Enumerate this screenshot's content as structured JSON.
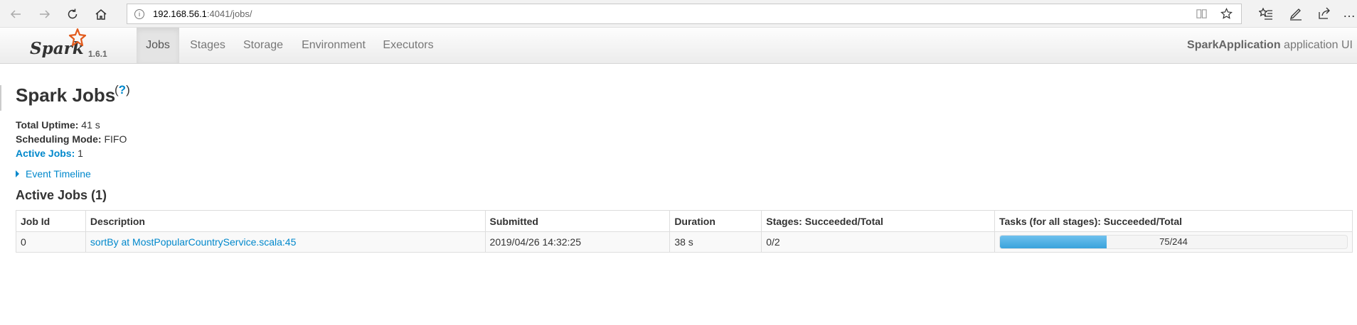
{
  "browser": {
    "url_host": "192.168.56.1",
    "url_rest": ":4041/jobs/"
  },
  "nav": {
    "version": "1.6.1",
    "logo_text": "Spark",
    "tabs": [
      {
        "label": "Jobs",
        "active": true
      },
      {
        "label": "Stages",
        "active": false
      },
      {
        "label": "Storage",
        "active": false
      },
      {
        "label": "Environment",
        "active": false
      },
      {
        "label": "Executors",
        "active": false
      }
    ],
    "app_name": "SparkApplication",
    "app_suffix": "application UI"
  },
  "page": {
    "title": "Spark Jobs",
    "help_mark": "?",
    "uptime_label": "Total Uptime:",
    "uptime_value": "41 s",
    "mode_label": "Scheduling Mode:",
    "mode_value": "FIFO",
    "active_label": "Active Jobs:",
    "active_value": "1",
    "timeline_label": "Event Timeline",
    "section_title": "Active Jobs (1)"
  },
  "table": {
    "headers": [
      "Job Id",
      "Description",
      "Submitted",
      "Duration",
      "Stages: Succeeded/Total",
      "Tasks (for all stages): Succeeded/Total"
    ],
    "rows": [
      {
        "job_id": "0",
        "description": "sortBy at MostPopularCountryService.scala:45",
        "submitted": "2019/04/26 14:32:25",
        "duration": "38 s",
        "stages": "0/2",
        "tasks_label": "75/244",
        "tasks_fraction": 0.307
      }
    ]
  },
  "colors": {
    "link": "#0088cc",
    "progress": "#3aa3dc",
    "logo_star": "#e25a1c"
  }
}
